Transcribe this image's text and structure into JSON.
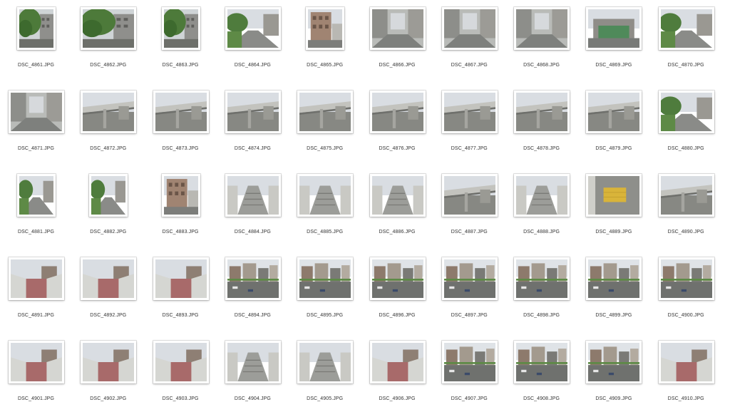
{
  "files": [
    {
      "name": "DSC_4861.JPG",
      "scene": "tree"
    },
    {
      "name": "DSC_4862.JPG",
      "scene": "tree"
    },
    {
      "name": "DSC_4863.JPG",
      "scene": "tree"
    },
    {
      "name": "DSC_4864.JPG",
      "scene": "street"
    },
    {
      "name": "DSC_4865.JPG",
      "scene": "building"
    },
    {
      "name": "DSC_4866.JPG",
      "scene": "alley"
    },
    {
      "name": "DSC_4867.JPG",
      "scene": "alley"
    },
    {
      "name": "DSC_4868.JPG",
      "scene": "alley"
    },
    {
      "name": "DSC_4869.JPG",
      "scene": "green"
    },
    {
      "name": "DSC_4870.JPG",
      "scene": "street"
    },
    {
      "name": "DSC_4871.JPG",
      "scene": "alley"
    },
    {
      "name": "DSC_4872.JPG",
      "scene": "bridge"
    },
    {
      "name": "DSC_4873.JPG",
      "scene": "bridge"
    },
    {
      "name": "DSC_4874.JPG",
      "scene": "bridge"
    },
    {
      "name": "DSC_4875.JPG",
      "scene": "bridge"
    },
    {
      "name": "DSC_4876.JPG",
      "scene": "bridge"
    },
    {
      "name": "DSC_4877.JPG",
      "scene": "bridge"
    },
    {
      "name": "DSC_4878.JPG",
      "scene": "bridge"
    },
    {
      "name": "DSC_4879.JPG",
      "scene": "bridge"
    },
    {
      "name": "DSC_4880.JPG",
      "scene": "street"
    },
    {
      "name": "DSC_4881.JPG",
      "scene": "street"
    },
    {
      "name": "DSC_4882.JPG",
      "scene": "street"
    },
    {
      "name": "DSC_4883.JPG",
      "scene": "building"
    },
    {
      "name": "DSC_4884.JPG",
      "scene": "stairs"
    },
    {
      "name": "DSC_4885.JPG",
      "scene": "stairs"
    },
    {
      "name": "DSC_4886.JPG",
      "scene": "stairs"
    },
    {
      "name": "DSC_4887.JPG",
      "scene": "bridge"
    },
    {
      "name": "DSC_4888.JPG",
      "scene": "stairs"
    },
    {
      "name": "DSC_4889.JPG",
      "scene": "tile"
    },
    {
      "name": "DSC_4890.JPG",
      "scene": "bridge"
    },
    {
      "name": "DSC_4891.JPG",
      "scene": "walkway"
    },
    {
      "name": "DSC_4892.JPG",
      "scene": "walkway"
    },
    {
      "name": "DSC_4893.JPG",
      "scene": "walkway"
    },
    {
      "name": "DSC_4894.JPG",
      "scene": "city"
    },
    {
      "name": "DSC_4895.JPG",
      "scene": "city"
    },
    {
      "name": "DSC_4896.JPG",
      "scene": "city"
    },
    {
      "name": "DSC_4897.JPG",
      "scene": "city"
    },
    {
      "name": "DSC_4898.JPG",
      "scene": "city"
    },
    {
      "name": "DSC_4899.JPG",
      "scene": "city"
    },
    {
      "name": "DSC_4900.JPG",
      "scene": "city"
    },
    {
      "name": "DSC_4901.JPG",
      "scene": "walkway"
    },
    {
      "name": "DSC_4902.JPG",
      "scene": "walkway"
    },
    {
      "name": "DSC_4903.JPG",
      "scene": "walkway"
    },
    {
      "name": "DSC_4904.JPG",
      "scene": "stairs"
    },
    {
      "name": "DSC_4905.JPG",
      "scene": "stairs"
    },
    {
      "name": "DSC_4906.JPG",
      "scene": "walkway"
    },
    {
      "name": "DSC_4907.JPG",
      "scene": "city"
    },
    {
      "name": "DSC_4908.JPG",
      "scene": "city"
    },
    {
      "name": "DSC_4909.JPG",
      "scene": "city"
    },
    {
      "name": "DSC_4910.JPG",
      "scene": "walkway"
    }
  ]
}
